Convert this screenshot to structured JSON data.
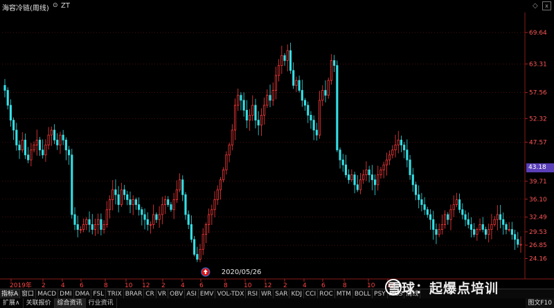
{
  "header": {
    "title": "海容冷链(周线)",
    "zt_icon": "circle-icon",
    "zt_label": "ZT",
    "nav_icon": "◇",
    "close_icon": "x"
  },
  "chart_data": {
    "type": "candlestick",
    "y_tick_labels": [
      "69.64",
      "63.31",
      "57.56",
      "52.32",
      "47.57",
      "39.71",
      "36.10",
      "32.49",
      "29.53",
      "26.85",
      "24.16"
    ],
    "current_price_label": "43.18",
    "x_tick_labels": [
      "2019年",
      "2",
      "4",
      "6",
      "8",
      "10",
      "12",
      "2",
      "4",
      "6",
      "8",
      "10",
      "12",
      "2",
      "4",
      "6",
      "8",
      "10",
      "12"
    ],
    "annotation": "2020/05/26",
    "colors": {
      "up": "#ff3b3b",
      "down": "#35e0e6",
      "grid": "#7a1a1a"
    }
  },
  "indicator_tabs": [
    "指标A",
    "窗口",
    "MACD",
    "DMI",
    "DMA",
    "FSL",
    "TRIX",
    "BRAR",
    "CR",
    "VR",
    "OBV",
    "ASI",
    "EMV",
    "VOL-TDX",
    "RSI",
    "WR",
    "SAR",
    "KDJ",
    "CCI",
    "ROC",
    "MTM",
    "BOLL",
    "PSY",
    "MCS",
    "周线"
  ],
  "bottom_tabs": [
    "扩展∧",
    "关联报价",
    "综合资讯",
    "行业资讯"
  ],
  "bottom_right": "图文F10",
  "watermark": "雪球：起爆点培训"
}
